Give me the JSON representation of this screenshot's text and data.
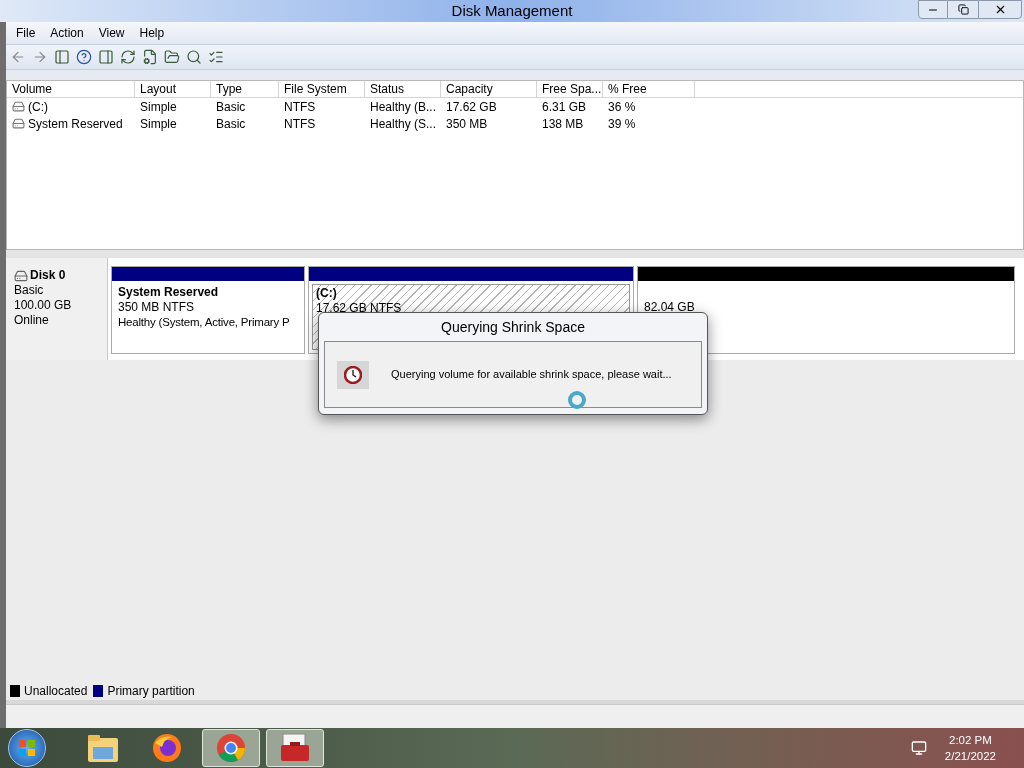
{
  "window": {
    "title": "Disk Management"
  },
  "menu": [
    "File",
    "Action",
    "View",
    "Help"
  ],
  "table": {
    "columns": [
      "Volume",
      "Layout",
      "Type",
      "File System",
      "Status",
      "Capacity",
      "Free Spa...",
      "% Free"
    ],
    "rows": [
      {
        "cells": [
          "(C:)",
          "Simple",
          "Basic",
          "NTFS",
          "Healthy (B...",
          "17.62 GB",
          "6.31 GB",
          "36 %"
        ]
      },
      {
        "cells": [
          "System Reserved",
          "Simple",
          "Basic",
          "NTFS",
          "Healthy (S...",
          "350 MB",
          "138 MB",
          "39 %"
        ]
      }
    ]
  },
  "disk": {
    "name": "Disk 0",
    "type": "Basic",
    "size": "100.00 GB",
    "status": "Online",
    "partitions": [
      {
        "kind": "primary",
        "selected": false,
        "title": "System Reserved",
        "lines": [
          "350 MB NTFS",
          "Healthy (System, Active, Primary P"
        ]
      },
      {
        "kind": "primary",
        "selected": true,
        "title": "(C:)",
        "lines": [
          "17.62 GB NTFS"
        ]
      },
      {
        "kind": "unallocated",
        "selected": false,
        "lines": [
          "82.04 GB"
        ]
      }
    ]
  },
  "legend": [
    {
      "label": "Unallocated",
      "color": "#000000"
    },
    {
      "label": "Primary partition",
      "color": "#000080"
    }
  ],
  "dialog": {
    "title": "Querying Shrink Space",
    "message": "Querying volume for available shrink space, please wait..."
  },
  "taskbar": {
    "apps": [
      {
        "kind": "explorer",
        "selected": false
      },
      {
        "kind": "firefox",
        "selected": false
      },
      {
        "kind": "chrome",
        "selected": true
      },
      {
        "kind": "diskmgmt",
        "selected": true
      }
    ],
    "time": "2:02 PM",
    "date": "2/21/2022"
  }
}
